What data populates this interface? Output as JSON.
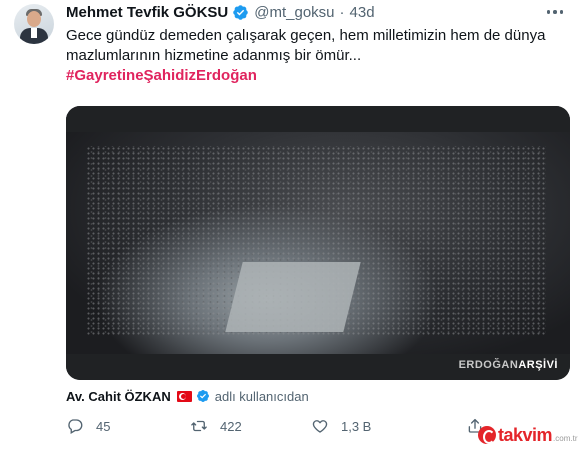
{
  "tweet": {
    "author_name": "Mehmet Tevfik GÖKSU",
    "author_handle": "@mt_goksu",
    "separator": "·",
    "time": "43d",
    "text_line_1": "Gece gündüz demeden çalışarak geçen, hem milletimizin hem de dünya",
    "text_line_2": "mazlumlarının hizmetine adanmış bir ömür...",
    "hashtag": "#GayretineŞahidizErdoğan"
  },
  "media": {
    "watermark_a": "ERDOĞAN",
    "watermark_b": "ARŞİVİ"
  },
  "tagged": {
    "name": "Av. Cahit ÖZKAN",
    "suffix": "adlı kullanıcıdan"
  },
  "actions": {
    "reply_count": "45",
    "retweet_count": "422",
    "like_count": "1,3 B"
  },
  "icons": {
    "verified": "verified-badge-icon",
    "more": "more-options-icon",
    "reply": "reply-icon",
    "retweet": "retweet-icon",
    "like": "like-icon",
    "share": "share-icon",
    "flag": "turkey-flag-icon"
  },
  "brand": {
    "site": "takvim",
    "tld": ".com.tr"
  },
  "colors": {
    "hashtag": "#e0245e",
    "verified": "#1d9bf0",
    "secondary_text": "#536471",
    "brand_red": "#e4252a"
  }
}
